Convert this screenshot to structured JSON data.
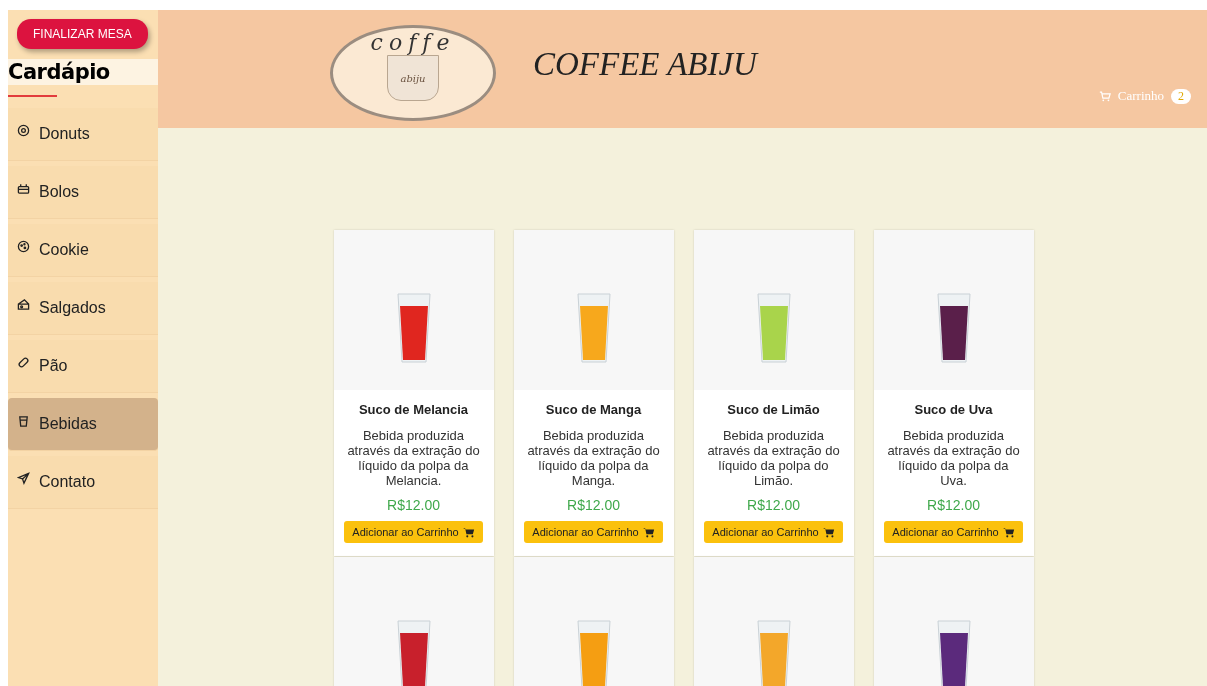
{
  "sidebar": {
    "finish_button": "FINALIZAR MESA",
    "title": "Cardápio",
    "items": [
      {
        "label": "Donuts",
        "selected": false
      },
      {
        "label": "Bolos",
        "selected": false
      },
      {
        "label": "Cookie",
        "selected": false
      },
      {
        "label": "Salgados",
        "selected": false
      },
      {
        "label": "Pão",
        "selected": false
      },
      {
        "label": "Bebidas",
        "selected": true
      },
      {
        "label": "Contato",
        "selected": false
      }
    ]
  },
  "header": {
    "logo_top": "coffe",
    "logo_cup": "abiju",
    "brand": "COFFEE ABIJU",
    "cart_label": "Carrinho",
    "cart_count": "2"
  },
  "products": [
    {
      "name": "Suco de Melancia",
      "description": "Bebida produzida através da extração do líquido da polpa da Melancia.",
      "price": "R$12.00",
      "button": "Adicionar ao Carrinho",
      "color": "#e0261f"
    },
    {
      "name": "Suco de Manga",
      "description": "Bebida produzida através da extração do líquido da polpa da Manga.",
      "price": "R$12.00",
      "button": "Adicionar ao Carrinho",
      "color": "#f7a81c"
    },
    {
      "name": "Suco de Limão",
      "description": "Bebida produzida através da extração do líquido da polpa do Limão.",
      "price": "R$12.00",
      "button": "Adicionar ao Carrinho",
      "color": "#a9d44b"
    },
    {
      "name": "Suco de Uva",
      "description": "Bebida produzida através da extração do líquido da polpa da Uva.",
      "price": "R$12.00",
      "button": "Adicionar ao Carrinho",
      "color": "#5a1f4a"
    }
  ],
  "more_cards": [
    {
      "kind": "photo",
      "color": "#c8202c"
    },
    {
      "kind": "photo",
      "color": "#f59e12"
    },
    {
      "kind": "photo",
      "color": "#f3a72a"
    },
    {
      "kind": "photo",
      "color": "#5b2a7c"
    }
  ]
}
